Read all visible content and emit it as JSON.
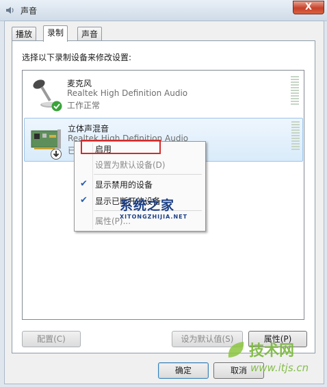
{
  "window": {
    "title": "声音",
    "close_label": "X"
  },
  "tabs": [
    {
      "label": "播放"
    },
    {
      "label": "录制"
    },
    {
      "label": "声音"
    }
  ],
  "instruction": "选择以下录制设备来修改设置:",
  "devices": [
    {
      "name": "麦克风",
      "description": "Realtek High Definition Audio",
      "status": "工作正常",
      "icon": "microphone-icon",
      "badge": "green-check-icon"
    },
    {
      "name": "立体声混音",
      "description": "Realtek High Definition Audio",
      "status": "已",
      "icon": "sound-card-icon",
      "badge": "disabled-down-arrow-icon"
    }
  ],
  "context_menu": {
    "items": [
      {
        "label": "启用",
        "checked": false,
        "enabled": true
      },
      {
        "label": "设置为默认设备(D)",
        "checked": false,
        "enabled": false
      },
      {
        "label": "显示禁用的设备",
        "checked": true,
        "enabled": true
      },
      {
        "label": "显示已断开的设备",
        "checked": true,
        "enabled": true
      },
      {
        "label": "属性(P)...",
        "checked": false,
        "enabled": false
      }
    ]
  },
  "buttons": {
    "configure": "配置(C)",
    "set_default": "设为默认值(S)",
    "properties": "属性(P)",
    "ok": "确定",
    "cancel": "取消"
  },
  "watermarks": {
    "site1_name": "系统之家",
    "site1_url": "XITONGZHIJIA.NET",
    "site2_name": "技术网",
    "site2_url": "www.itjs.cn"
  },
  "colors": {
    "accent": "#3c7fb1",
    "highlight_box": "#d32a2a",
    "check": "#2a5ea8"
  }
}
